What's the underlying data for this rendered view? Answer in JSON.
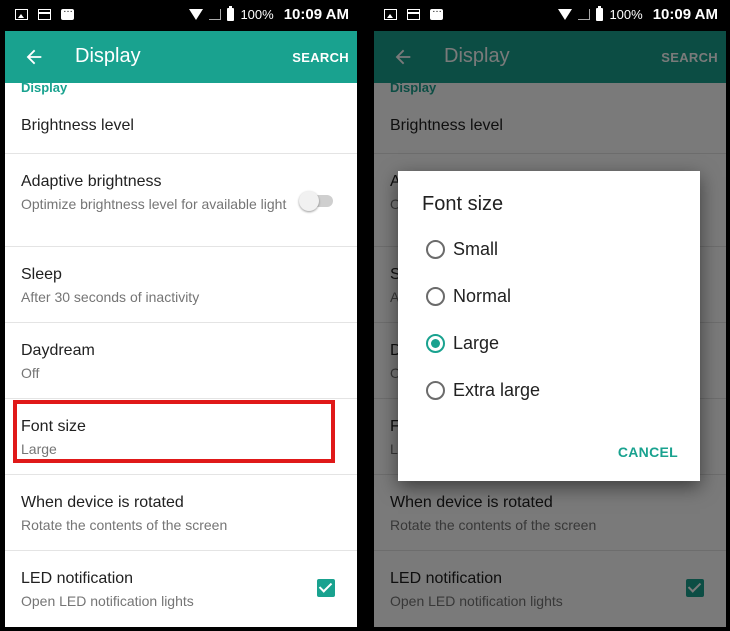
{
  "status_bar": {
    "battery": "100%",
    "time": "10:09 AM"
  },
  "app_bar": {
    "title": "Display",
    "search_label": "SEARCH"
  },
  "section_label": "Display",
  "items": {
    "brightness": {
      "title": "Brightness level"
    },
    "adaptive": {
      "title": "Adaptive brightness",
      "summary": "Optimize brightness level for available light",
      "toggle_on": false
    },
    "sleep": {
      "title": "Sleep",
      "summary": "After 30 seconds of inactivity"
    },
    "daydream": {
      "title": "Daydream",
      "summary": "Off"
    },
    "font_size": {
      "title": "Font size",
      "summary": "Large"
    },
    "rotation": {
      "title": "When device is rotated",
      "summary": "Rotate the contents of the screen"
    },
    "led": {
      "title": "LED notification",
      "summary": "Open LED notification lights",
      "checked": true
    }
  },
  "dialog": {
    "title": "Font size",
    "options": [
      "Small",
      "Normal",
      "Large",
      "Extra large"
    ],
    "selected": "Large",
    "cancel_label": "CANCEL"
  },
  "colors": {
    "accent": "#19a28f",
    "highlight": "#e01919"
  }
}
